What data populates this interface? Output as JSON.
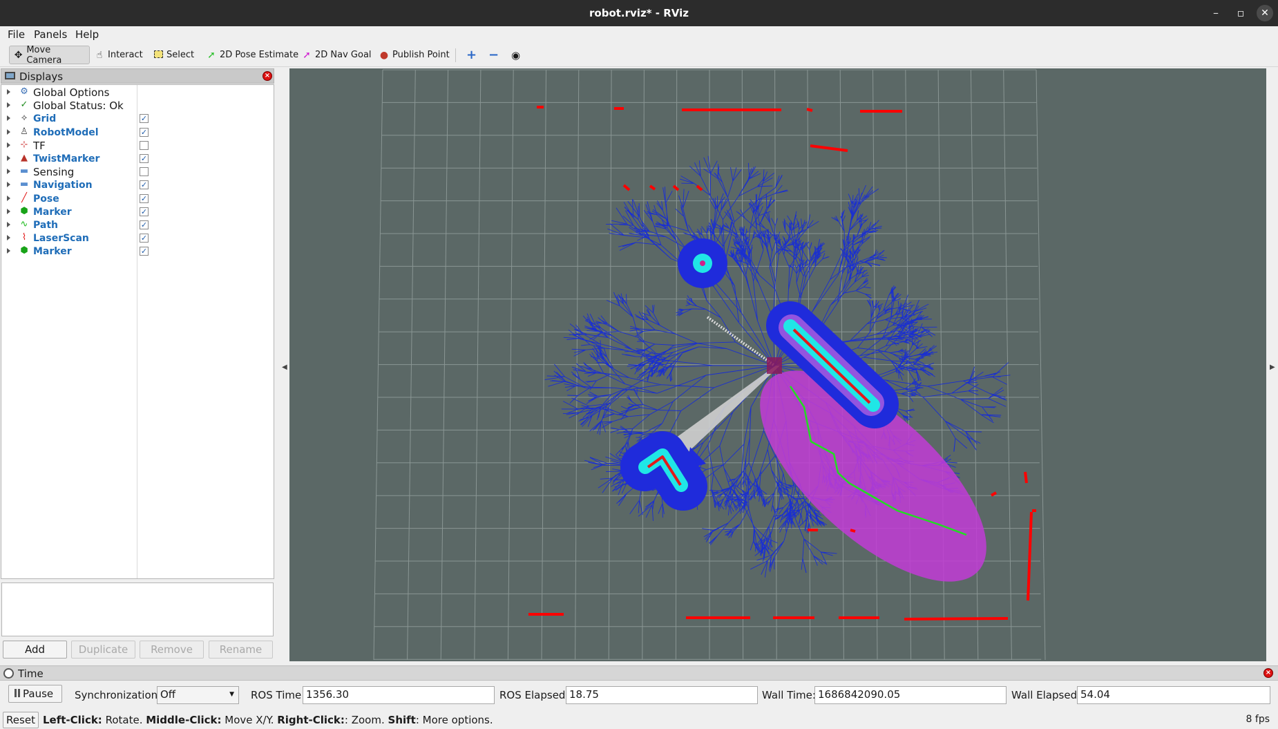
{
  "window": {
    "title": "robot.rviz* - RViz"
  },
  "menu": {
    "file": "File",
    "panels": "Panels",
    "help": "Help"
  },
  "toolbar": {
    "move_camera": "Move Camera",
    "interact": "Interact",
    "select": "Select",
    "pose_estimate": "2D Pose Estimate",
    "nav_goal": "2D Nav Goal",
    "publish_point": "Publish Point"
  },
  "displays": {
    "title": "Displays",
    "items": [
      {
        "label": "Global Options",
        "icon": "gear-icon",
        "checkbox": null
      },
      {
        "label": "Global Status: Ok",
        "icon": "check-icon",
        "checkbox": null
      },
      {
        "label": "Grid",
        "icon": "grid-icon",
        "checkbox": true
      },
      {
        "label": "RobotModel",
        "icon": "robot-icon",
        "checkbox": true
      },
      {
        "label": "TF",
        "icon": "axes-icon",
        "checkbox": false
      },
      {
        "label": "TwistMarker",
        "icon": "twist-icon",
        "checkbox": true
      },
      {
        "label": "Sensing",
        "icon": "folder-icon",
        "checkbox": false
      },
      {
        "label": "Navigation",
        "icon": "folder-icon",
        "checkbox": true
      },
      {
        "label": "Pose",
        "icon": "arrow-icon",
        "checkbox": true
      },
      {
        "label": "Marker",
        "icon": "cube-icon",
        "checkbox": true
      },
      {
        "label": "Path",
        "icon": "path-icon",
        "checkbox": true
      },
      {
        "label": "LaserScan",
        "icon": "laser-icon",
        "checkbox": true
      },
      {
        "label": "Marker",
        "icon": "cube-icon",
        "checkbox": true
      }
    ],
    "buttons": {
      "add": "Add",
      "duplicate": "Duplicate",
      "remove": "Remove",
      "rename": "Rename"
    }
  },
  "time": {
    "title": "Time",
    "pause": "Pause",
    "sync_label": "Synchronization:",
    "sync_value": "Off",
    "ros_time_label": "ROS Time:",
    "ros_time": "1356.30",
    "ros_elapsed_label": "ROS Elapsed:",
    "ros_elapsed": "18.75",
    "wall_time_label": "Wall Time:",
    "wall_time": "1686842090.05",
    "wall_elapsed_label": "Wall Elapsed:",
    "wall_elapsed": "54.04"
  },
  "status": {
    "reset": "Reset",
    "left_click": "Left-Click:",
    "left_desc": " Rotate. ",
    "middle_click": "Middle-Click:",
    "middle_desc": " Move X/Y. ",
    "right_click": "Right-Click:",
    "right_desc": ": Zoom. ",
    "shift": "Shift",
    "shift_desc": ": More options.",
    "fps": "8 fps"
  },
  "colors": {
    "background": "#5b6866",
    "tree": "#1a2fd0",
    "laser": "#ff0000",
    "path": "#22dd22",
    "costmap": "#c23cd6"
  }
}
